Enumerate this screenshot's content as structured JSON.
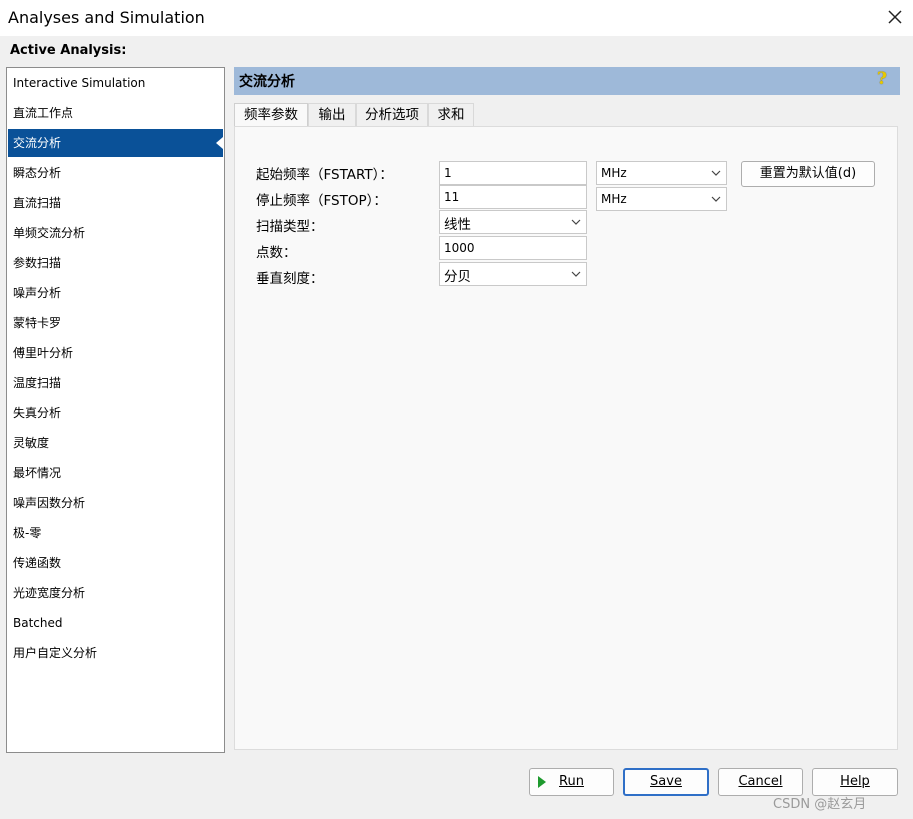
{
  "window": {
    "title": "Analyses and Simulation"
  },
  "sidebar": {
    "section_label": "Active Analysis:",
    "items": [
      {
        "label": "Interactive Simulation"
      },
      {
        "label": "直流工作点"
      },
      {
        "label": "交流分析",
        "selected": true
      },
      {
        "label": "瞬态分析"
      },
      {
        "label": "直流扫描"
      },
      {
        "label": "单频交流分析"
      },
      {
        "label": "参数扫描"
      },
      {
        "label": "噪声分析"
      },
      {
        "label": "蒙特卡罗"
      },
      {
        "label": "傅里叶分析"
      },
      {
        "label": "温度扫描"
      },
      {
        "label": "失真分析"
      },
      {
        "label": "灵敏度"
      },
      {
        "label": "最坏情况"
      },
      {
        "label": "噪声因数分析"
      },
      {
        "label": "极-零"
      },
      {
        "label": "传递函数"
      },
      {
        "label": "光迹宽度分析"
      },
      {
        "label": "Batched"
      },
      {
        "label": "用户自定义分析"
      }
    ]
  },
  "panel": {
    "title": "交流分析",
    "help_icon": "help-question-icon",
    "tabs": [
      {
        "label": "频率参数",
        "active": true
      },
      {
        "label": "输出"
      },
      {
        "label": "分析选项"
      },
      {
        "label": "求和"
      }
    ],
    "form": {
      "fstart_label": "起始频率（FSTART）：",
      "fstart_value": "1",
      "fstart_unit": "MHz",
      "fstop_label": "停止频率（FSTOP）：",
      "fstop_value": "11",
      "fstop_unit": "MHz",
      "sweep_type_label": "扫描类型：",
      "sweep_type_value": "线性",
      "points_label": "点数：",
      "points_value": "1000",
      "vscale_label": "垂直刻度：",
      "vscale_value": "分贝",
      "reset_button": "重置为默认值(d)"
    }
  },
  "footer": {
    "run": "Run",
    "save": "Save",
    "cancel": "Cancel",
    "help": "Help"
  },
  "watermark": "CSDN @赵玄月",
  "colors": {
    "selection": "#0a5198",
    "header_bar": "#9eb9d9",
    "run_icon": "#1e9a2e",
    "default_button_border": "#2f6fc7"
  }
}
